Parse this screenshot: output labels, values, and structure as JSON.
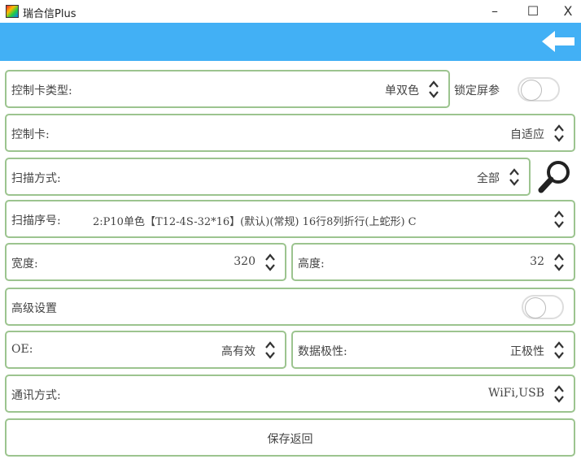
{
  "window": {
    "title": "瑞合信Plus",
    "minimize": "–",
    "maximize": "☐",
    "close": "X"
  },
  "form": {
    "card_type": {
      "label": "控制卡类型:",
      "value": "单双色"
    },
    "lock": {
      "label": "锁定屏参",
      "on": false
    },
    "card": {
      "label": "控制卡:",
      "value": "自适应"
    },
    "scan_mode": {
      "label": "扫描方式:",
      "value": "全部"
    },
    "scan_no": {
      "label": "扫描序号:",
      "value": "2:P10单色【T12-4S-32*16】(默认)(常规) 16行8列折行(上蛇形) C"
    },
    "width": {
      "label": "宽度:",
      "value": "320"
    },
    "height": {
      "label": "高度:",
      "value": "32"
    },
    "advanced": {
      "label": "高级设置",
      "on": false
    },
    "oe": {
      "label": "OE:",
      "value": "高有效"
    },
    "polarity": {
      "label": "数据极性:",
      "value": "正极性"
    },
    "comm": {
      "label": "通讯方式:",
      "value": "WiFi,USB"
    },
    "save": "保存返回"
  }
}
